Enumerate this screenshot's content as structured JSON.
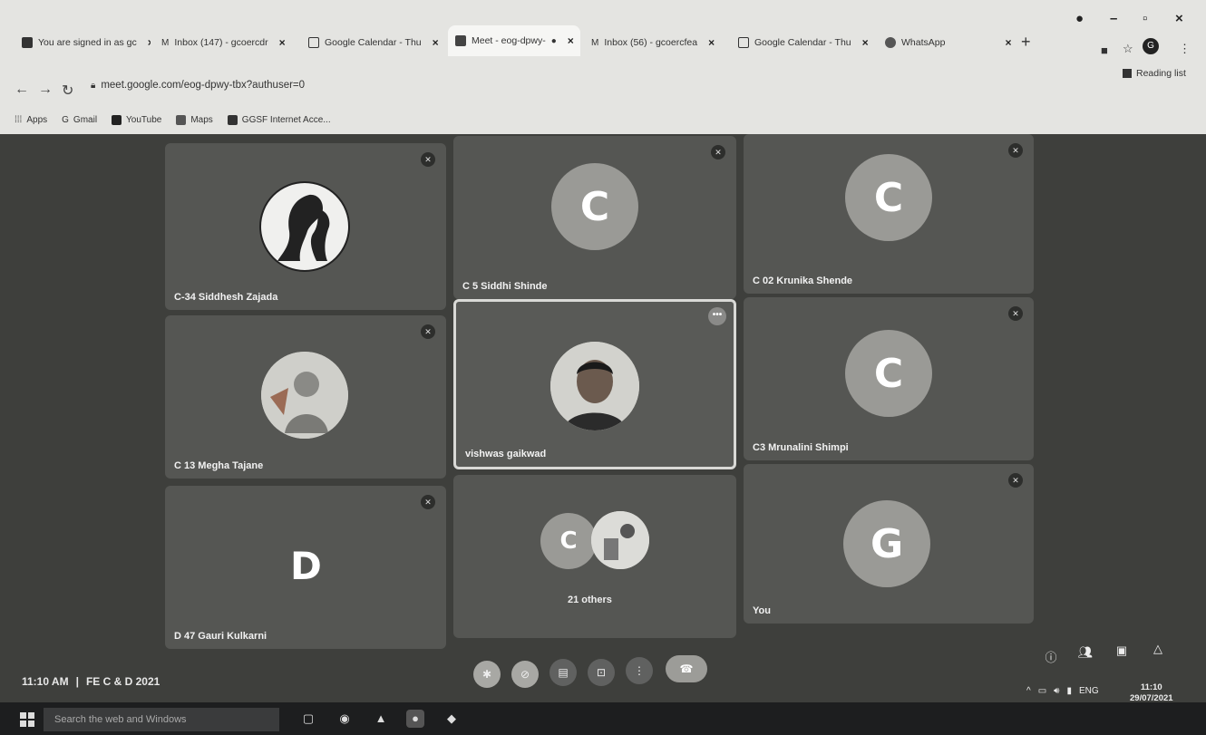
{
  "browser": {
    "tabs": [
      {
        "label": "You are signed in as gc",
        "favicon": "ggsf-icon",
        "active": false
      },
      {
        "label": "Inbox (147) - gcoercdr",
        "favicon": "gmail-icon",
        "active": false
      },
      {
        "label": "Google Calendar - Thu",
        "favicon": "calendar-icon",
        "active": false
      },
      {
        "label": "Meet - eog-dpwy-",
        "favicon": "meet-icon",
        "active": true
      },
      {
        "label": "Inbox (56) - gcoercfea",
        "favicon": "gmail-icon",
        "active": false
      },
      {
        "label": "Google Calendar - Thu",
        "favicon": "calendar-icon",
        "active": false
      },
      {
        "label": "WhatsApp",
        "favicon": "whatsapp-icon",
        "active": false
      }
    ],
    "new_tab": "+",
    "address": "meet.google.com/eog-dpwy-tbx?authuser=0",
    "profile_initial": "G",
    "reading_list": "Reading list",
    "bookmarks": [
      {
        "label": "Apps",
        "icon": "apps-grid-icon"
      },
      {
        "label": "Gmail",
        "icon": "google-icon"
      },
      {
        "label": "YouTube",
        "icon": "youtube-icon"
      },
      {
        "label": "Maps",
        "icon": "maps-icon"
      },
      {
        "label": "GGSF Internet Acce...",
        "icon": "ggsf-icon"
      }
    ]
  },
  "meet": {
    "participants": [
      {
        "name": "C-34 Siddhesh Zajada",
        "avatar": "photo-silhouette",
        "muted": true
      },
      {
        "name": "C 5 Siddhi Shinde",
        "avatar": "C",
        "muted": true
      },
      {
        "name": "C 02 Krunika Shende",
        "avatar": "C",
        "muted": true
      },
      {
        "name": "C 13 Megha Tajane",
        "avatar": "photo-sketch",
        "muted": true
      },
      {
        "name": "vishwas gaikwad",
        "avatar": "photo-man",
        "muted": false,
        "active_speaker": true
      },
      {
        "name": "C3 Mrunalini Shimpi",
        "avatar": "C",
        "muted": true
      },
      {
        "name": "D 47 Gauri Kulkarni",
        "avatar": "D",
        "muted": true
      },
      {
        "name": "",
        "avatar": "group",
        "group_letter": "C",
        "others_label": "21 others"
      },
      {
        "name": "You",
        "avatar": "G",
        "muted": true
      }
    ],
    "meeting_time": "11:10 AM",
    "meeting_name": "FE C & D 2021",
    "separator": "|"
  },
  "taskbar": {
    "search_placeholder": "Search the web and Windows",
    "language": "ENG",
    "time": "11:10",
    "date": "29/07/2021"
  },
  "colors": {
    "tile_bg": "#555653",
    "stage_bg": "#3e3f3c",
    "avatar_bg": "#9a9a96"
  }
}
